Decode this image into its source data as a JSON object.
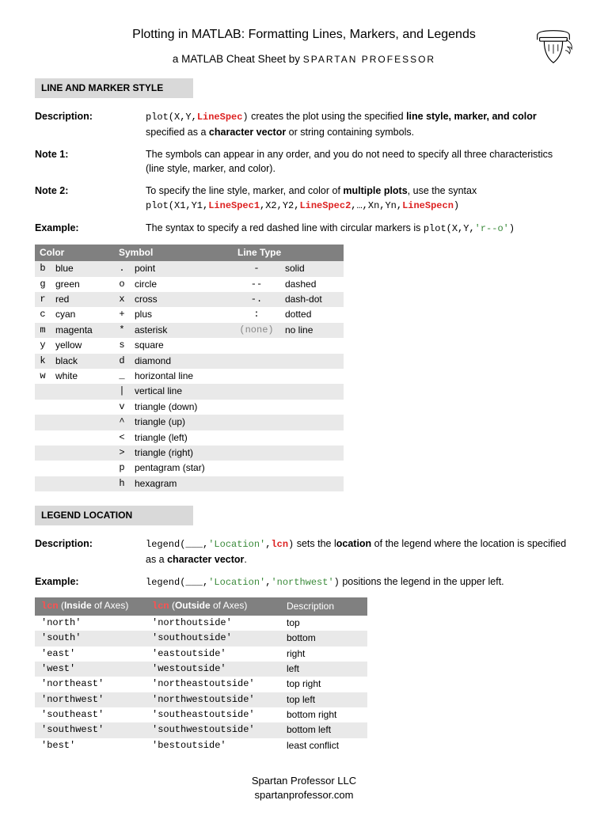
{
  "header": {
    "title": "Plotting in MATLAB: Formatting Lines, Markers, and Legends",
    "subtitle_prefix": "a MATLAB Cheat Sheet by ",
    "brand": "SPARTAN PROFESSOR"
  },
  "section1": {
    "heading": "LINE AND MARKER STYLE",
    "desc_label": "Description:",
    "desc_code_pre": "plot(X,Y,",
    "desc_code_spec": "LineSpec",
    "desc_code_post": ")",
    "desc_text_1": " creates the plot using the specified ",
    "desc_bold_1": "line style, marker, and color",
    "desc_text_2": " specified as a ",
    "desc_bold_2": "character vector",
    "desc_text_3": " or string containing symbols.",
    "note1_label": "Note 1:",
    "note1_text": "The symbols can appear in any order, and you do not need to specify all three characteristics (line style, marker, and color).",
    "note2_label": "Note 2:",
    "note2_text_1": "To specify the line style, marker, and color of ",
    "note2_bold": "multiple plots",
    "note2_text_2": ", use the syntax",
    "note2_code_full": "plot(X1,Y1,LineSpec1,X2,Y2,LineSpec2,…,Xn,Yn,LineSpecn)",
    "example_label": "Example:",
    "example_text": "The syntax to specify a red dashed line with circular markers is ",
    "example_code": "plot(X,Y,",
    "example_code_arg": "'r--o'",
    "example_code_end": ")"
  },
  "style_table": {
    "headers": {
      "color": "Color",
      "symbol": "Symbol",
      "linetype": "Line Type"
    },
    "rows": [
      {
        "cc": "b",
        "cname": "blue",
        "sc": ".",
        "sname": "point",
        "lc": "-",
        "lname": "solid"
      },
      {
        "cc": "g",
        "cname": "green",
        "sc": "o",
        "sname": "circle",
        "lc": "--",
        "lname": "dashed"
      },
      {
        "cc": "r",
        "cname": "red",
        "sc": "x",
        "sname": "cross",
        "lc": "-.",
        "lname": "dash-dot"
      },
      {
        "cc": "c",
        "cname": "cyan",
        "sc": "+",
        "sname": "plus",
        "lc": ":",
        "lname": "dotted"
      },
      {
        "cc": "m",
        "cname": "magenta",
        "sc": "*",
        "sname": "asterisk",
        "lc": "(none)",
        "lname": "no line"
      },
      {
        "cc": "y",
        "cname": "yellow",
        "sc": "s",
        "sname": "square",
        "lc": "",
        "lname": ""
      },
      {
        "cc": "k",
        "cname": "black",
        "sc": "d",
        "sname": "diamond",
        "lc": "",
        "lname": ""
      },
      {
        "cc": "w",
        "cname": "white",
        "sc": "_",
        "sname": "horizontal line",
        "lc": "",
        "lname": ""
      },
      {
        "cc": "",
        "cname": "",
        "sc": "|",
        "sname": "vertical line",
        "lc": "",
        "lname": ""
      },
      {
        "cc": "",
        "cname": "",
        "sc": "v",
        "sname": "triangle (down)",
        "lc": "",
        "lname": ""
      },
      {
        "cc": "",
        "cname": "",
        "sc": "^",
        "sname": "triangle (up)",
        "lc": "",
        "lname": ""
      },
      {
        "cc": "",
        "cname": "",
        "sc": "<",
        "sname": "triangle (left)",
        "lc": "",
        "lname": ""
      },
      {
        "cc": "",
        "cname": "",
        "sc": ">",
        "sname": "triangle (right)",
        "lc": "",
        "lname": ""
      },
      {
        "cc": "",
        "cname": "",
        "sc": "p",
        "sname": "pentagram (star)",
        "lc": "",
        "lname": ""
      },
      {
        "cc": "",
        "cname": "",
        "sc": "h",
        "sname": "hexagram",
        "lc": "",
        "lname": ""
      }
    ]
  },
  "section2": {
    "heading": "LEGEND LOCATION",
    "desc_label": "Description:",
    "desc_code_pre": "legend(___,",
    "desc_code_loc": "'Location'",
    "desc_code_mid": ",",
    "desc_code_lcn": "lcn",
    "desc_code_post": ")",
    "desc_text_1": " sets the l",
    "desc_bold": "ocation",
    "desc_text_2": " of the legend where the location is specified as a ",
    "desc_bold_2": "character vector",
    "desc_text_3": ".",
    "example_label": "Example:",
    "example_code_pre": "legend(___,",
    "example_code_loc": "'Location'",
    "example_code_mid": ",",
    "example_code_arg": "'northwest'",
    "example_code_post": ")",
    "example_text": " positions the legend in the upper left."
  },
  "loc_table": {
    "headers": {
      "inside_pre": " (",
      "inside_bold": "Inside",
      "inside_post": " of Axes)",
      "outside_pre": " (",
      "outside_bold": "Outside",
      "outside_post": " of Axes)",
      "desc": "Description",
      "lcn": "lcn"
    },
    "rows": [
      {
        "in": "'north'",
        "out": "'northoutside'",
        "desc": "top"
      },
      {
        "in": "'south'",
        "out": "'southoutside'",
        "desc": "bottom"
      },
      {
        "in": "'east'",
        "out": "'eastoutside'",
        "desc": "right"
      },
      {
        "in": "'west'",
        "out": "'westoutside'",
        "desc": "left"
      },
      {
        "in": "'northeast'",
        "out": "'northeastoutside'",
        "desc": "top right"
      },
      {
        "in": "'northwest'",
        "out": "'northwestoutside'",
        "desc": "top left"
      },
      {
        "in": "'southeast'",
        "out": "'southeastoutside'",
        "desc": "bottom right"
      },
      {
        "in": "'southwest'",
        "out": "'southwestoutside'",
        "desc": "bottom left"
      },
      {
        "in": "'best'",
        "out": "'bestoutside'",
        "desc": "least conflict"
      }
    ]
  },
  "footer": {
    "line1": "Spartan Professor LLC",
    "line2": "spartanprofessor.com"
  }
}
